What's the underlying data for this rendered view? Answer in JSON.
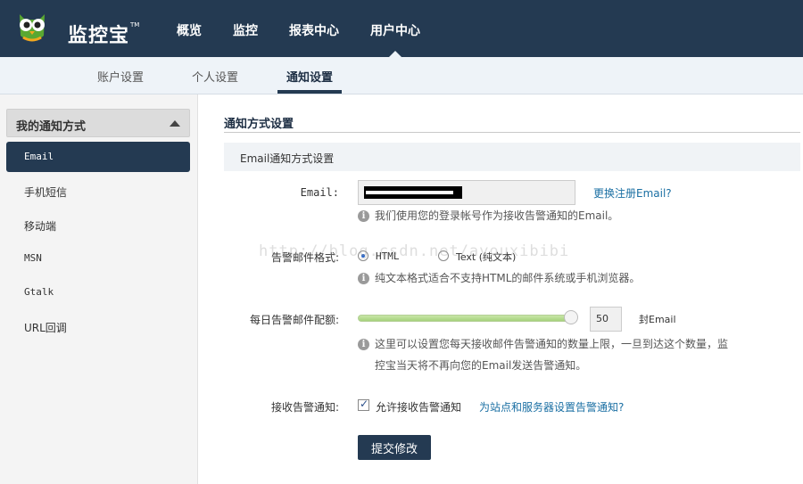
{
  "brand": {
    "name": "监控宝",
    "tm": "TM"
  },
  "topnav": {
    "items": [
      "概览",
      "监控",
      "报表中心",
      "用户中心"
    ],
    "active": "用户中心"
  },
  "subnav": {
    "items": [
      "账户设置",
      "个人设置",
      "通知设置"
    ],
    "active": "通知设置"
  },
  "sidebar": {
    "header": "我的通知方式",
    "items": [
      "Email",
      "手机短信",
      "移动端",
      "MSN",
      "Gtalk",
      "URL回调"
    ],
    "active": "Email"
  },
  "content": {
    "section_title": "通知方式设置",
    "sub_title": "Email通知方式设置",
    "email": {
      "label": "Email:",
      "change_link": "更换注册Email?",
      "hint": "我们使用您的登录帐号作为接收告警通知的Email。"
    },
    "format": {
      "label": "告警邮件格式:",
      "options": [
        "HTML",
        "Text (纯文本)"
      ],
      "selected": "HTML",
      "hint": "纯文本格式适合不支持HTML的邮件系统或手机浏览器。"
    },
    "quota": {
      "label": "每日告警邮件配额:",
      "value": "50",
      "unit": "封Email",
      "slider_fraction": 1.0,
      "hint_line1": "这里可以设置您每天接收邮件告警通知的数量上限，一旦到达这个数量，监",
      "hint_line2": "控宝当天将不再向您的Email发送告警通知。"
    },
    "receive": {
      "label": "接收告警通知:",
      "checkbox_label": "允许接收告警通知",
      "checked": true,
      "link": "为站点和服务器设置告警通知?"
    },
    "submit_label": "提交修改"
  },
  "watermark": "http://blog.csdn.net/ayouxibibi",
  "colors": {
    "nav": "#243a52",
    "link": "#1a6fa3",
    "slider": "#a6d27c"
  }
}
